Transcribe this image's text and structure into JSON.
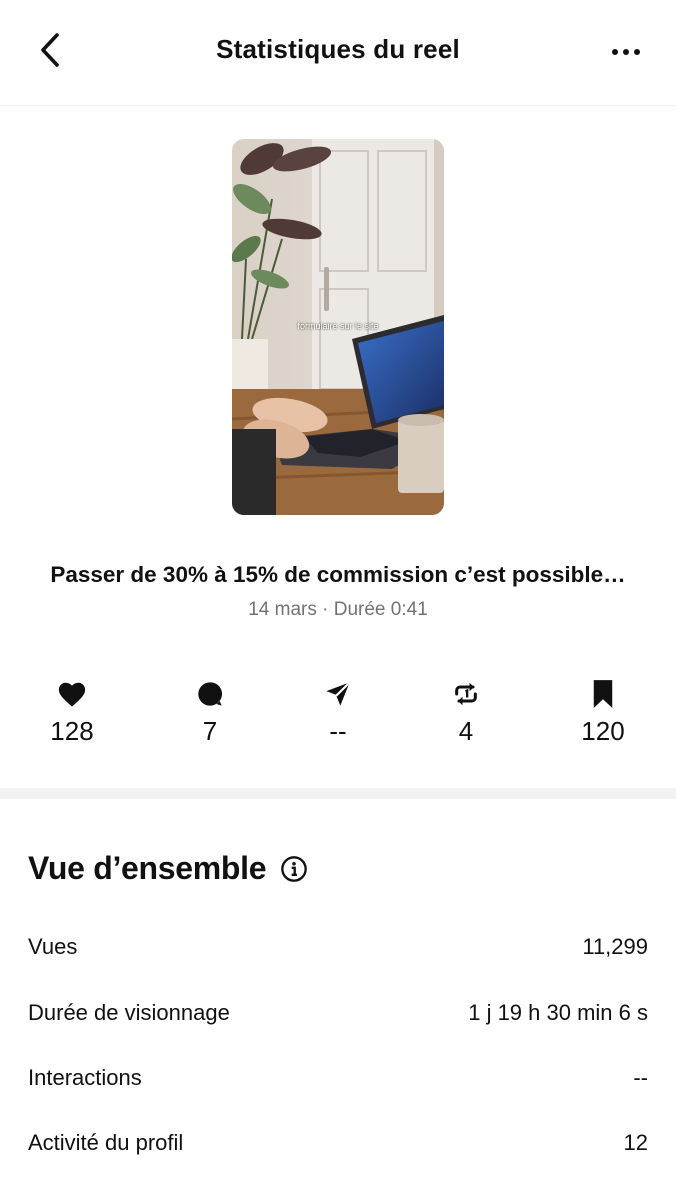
{
  "header": {
    "title": "Statistiques du reel",
    "back_icon": "chevron-left-icon",
    "more_icon": "more-horizontal-icon"
  },
  "thumbnail": {
    "overlay_text": "formulaire sur le site"
  },
  "reel": {
    "title": "Passer de 30% à 15% de commission c’est possible…",
    "meta": "14 mars · Durée 0:41"
  },
  "metrics": [
    {
      "icon": "heart-icon",
      "value": "128"
    },
    {
      "icon": "comment-icon",
      "value": "7"
    },
    {
      "icon": "share-icon",
      "value": "--"
    },
    {
      "icon": "repost-icon",
      "value": "4"
    },
    {
      "icon": "bookmark-icon",
      "value": "120"
    }
  ],
  "overview": {
    "title": "Vue d’ensemble",
    "rows": [
      {
        "label": "Vues",
        "value": "11,299"
      },
      {
        "label": "Durée de visionnage",
        "value": "1 j 19 h 30 min 6 s"
      },
      {
        "label": "Interactions",
        "value": "--"
      },
      {
        "label": "Activité du profil",
        "value": "12"
      }
    ]
  }
}
